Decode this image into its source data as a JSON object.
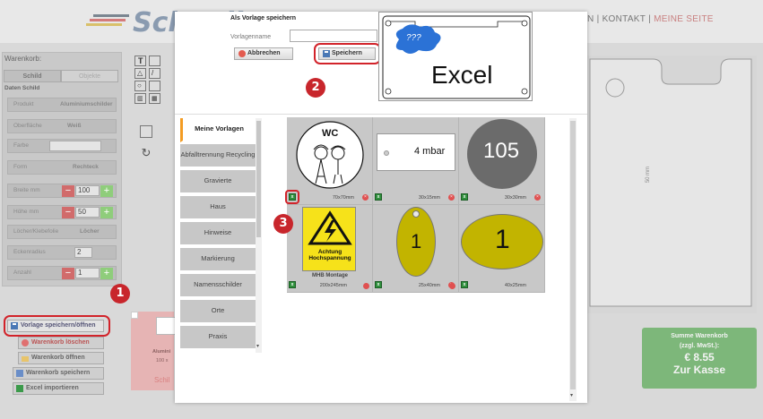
{
  "header": {
    "logo_text": "Schnell",
    "nav_items": [
      "EN",
      "KONTAKT",
      "MEINE SEITE"
    ]
  },
  "sidebar": {
    "title": "Warenkorb:",
    "tabs": [
      "Schild",
      "Objekte"
    ],
    "section": "Daten Schild",
    "rows": [
      {
        "label": "Produkt",
        "value": "Aluminiumschilder"
      },
      {
        "label": "Oberfläche",
        "value": "Weiß"
      },
      {
        "label": "Farbe",
        "value": ""
      },
      {
        "label": "Form",
        "value": "Rechteck"
      },
      {
        "label": "Breite mm",
        "value": "100"
      },
      {
        "label": "Höhe mm",
        "value": "50"
      },
      {
        "label": "Löcher/Klebefolie",
        "value": "Löcher"
      },
      {
        "label": "Eckenradius",
        "value": "2"
      },
      {
        "label": "Anzahl",
        "value": "1"
      }
    ],
    "buttons": [
      "Vorlage speichern/öffnen",
      "Warenkorb löschen",
      "Warenkorb öffnen",
      "Warenkorb speichern",
      "Excel importieren"
    ]
  },
  "canvas": {
    "dimension_label": "50 mm"
  },
  "cart_summary": {
    "line1": "Summe Warenkorb",
    "line2": "(zzgl. MwSt.):",
    "price": "€ 8.55",
    "checkout": "Zur Kasse"
  },
  "pink_panel": {
    "label1": "Alumini",
    "label2": "100 x",
    "label3": "Schil"
  },
  "modal": {
    "save_title": "Als Vorlage speichern",
    "name_label": "Vorlagenname",
    "name_value": "",
    "cancel_label": "Abbrechen",
    "save_label": "Speichern",
    "preview": {
      "cloud_text": "???",
      "main_text": "Excel"
    },
    "categories": [
      "Meine Vorlagen",
      "Abfalltrennung Recycling",
      "Gravierte",
      "Haus",
      "Hinweise",
      "Markierung",
      "Namensschilder",
      "Orte",
      "Praxis"
    ],
    "templates": [
      {
        "text": "WC",
        "size": "70x70mm"
      },
      {
        "text": "4 mbar",
        "size": "30x15mm"
      },
      {
        "text": "105",
        "size": "30x30mm"
      },
      {
        "text": "Achtung\nHochspannung",
        "caption": "MHB Montage",
        "size": "200x245mm"
      },
      {
        "text": "1",
        "size": "25x40mm"
      },
      {
        "text": "1",
        "size": "40x25mm"
      }
    ]
  },
  "badges": [
    "1",
    "2",
    "3"
  ],
  "accent": "#d2232a"
}
